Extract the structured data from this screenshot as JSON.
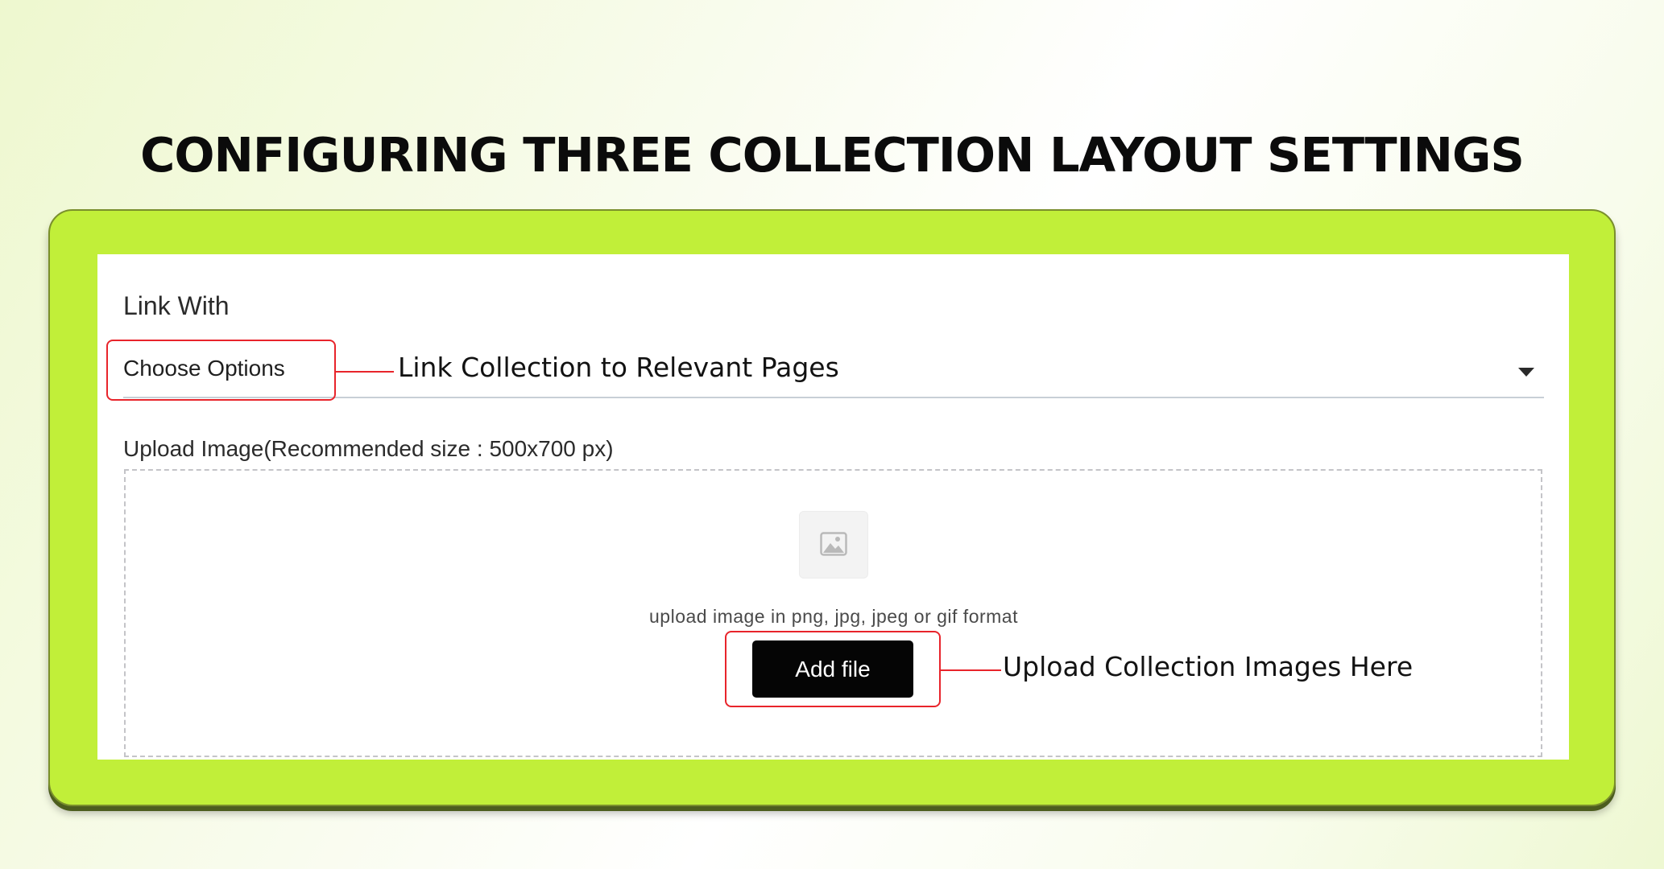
{
  "page_title": "CONFIGURING THREE COLLECTION LAYOUT SETTINGS",
  "form": {
    "link_with_label": "Link With",
    "link_with_value": "Choose Options",
    "upload_label": "Upload Image(Recommended size : 500x700 px)",
    "upload_hint": "upload image in png, jpg, jpeg or gif format",
    "add_file_label": "Add file"
  },
  "annotations": {
    "select_callout": "Link Collection to Relevant Pages",
    "upload_callout": "Upload Collection Images Here"
  },
  "icons": {
    "dropdown": "caret-down-icon",
    "image_placeholder": "image-icon"
  },
  "colors": {
    "card_accent": "#c1ef39",
    "highlight": "#e8242b",
    "button": "#050505"
  }
}
